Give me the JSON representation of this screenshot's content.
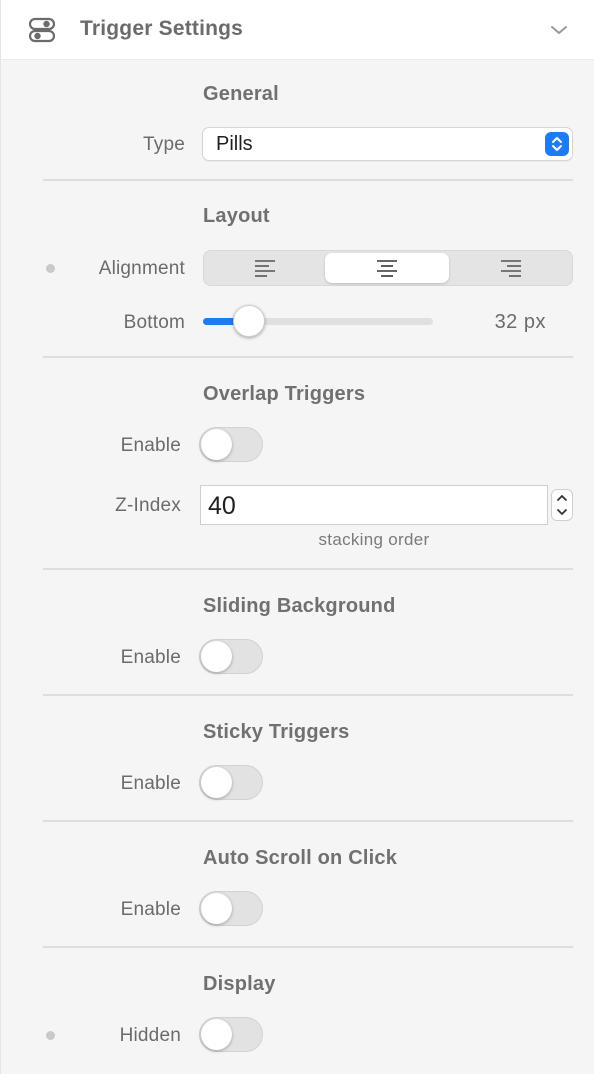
{
  "header": {
    "title": "Trigger Settings",
    "icon": "toggle-settings-icon",
    "collapse_icon": "chevron-down-icon"
  },
  "general": {
    "title": "General",
    "type_label": "Type",
    "type_value": "Pills"
  },
  "layout": {
    "title": "Layout",
    "alignment_label": "Alignment",
    "alignment_options": [
      "align-left-icon",
      "align-center-icon",
      "align-right-icon"
    ],
    "alignment_selected": "center",
    "bottom_label": "Bottom",
    "bottom_value": "32 px",
    "bottom_fraction": 0.2
  },
  "overlap": {
    "title": "Overlap Triggers",
    "enable_label": "Enable",
    "enabled": false,
    "zindex_label": "Z-Index",
    "zindex_value": "40",
    "zindex_hint": "stacking order"
  },
  "sliding": {
    "title": "Sliding Background",
    "enable_label": "Enable",
    "enabled": false
  },
  "sticky": {
    "title": "Sticky Triggers",
    "enable_label": "Enable",
    "enabled": false
  },
  "autoscroll": {
    "title": "Auto Scroll on Click",
    "enable_label": "Enable",
    "enabled": false
  },
  "display": {
    "title": "Display",
    "hidden_label": "Hidden",
    "enabled": false
  },
  "colors": {
    "accent": "#1f7cf0",
    "text": "#6b6b6b",
    "background": "#f5f5f5"
  }
}
